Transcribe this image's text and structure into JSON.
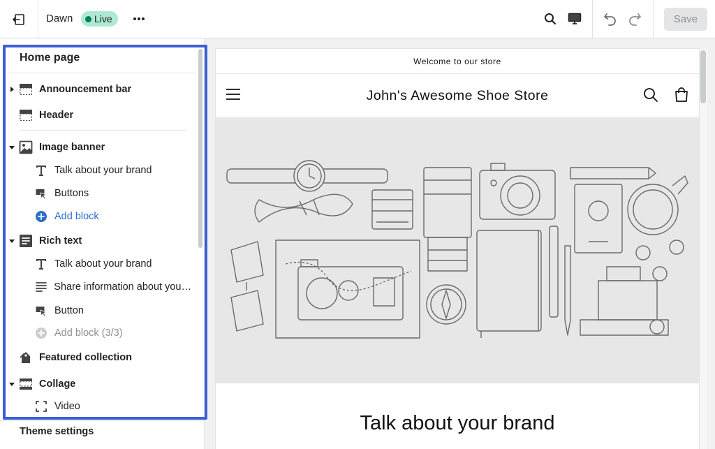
{
  "topbar": {
    "theme_name": "Dawn",
    "live_label": "Live",
    "save_label": "Save"
  },
  "sidebar": {
    "title": "Home page",
    "header_sections": [
      {
        "label": "Announcement bar",
        "icon": "announcement-bar-icon",
        "expandable": true
      },
      {
        "label": "Header",
        "icon": "header-icon",
        "expandable": false
      }
    ],
    "image_banner": {
      "label": "Image banner",
      "icon": "image-icon",
      "children": [
        {
          "label": "Talk about your brand",
          "icon": "text-icon"
        },
        {
          "label": "Buttons",
          "icon": "button-icon"
        }
      ],
      "add_label": "Add block"
    },
    "rich_text": {
      "label": "Rich text",
      "icon": "rich-text-icon",
      "children": [
        {
          "label": "Talk about your brand",
          "icon": "text-icon"
        },
        {
          "label": "Share information about your ...",
          "icon": "paragraph-icon"
        },
        {
          "label": "Button",
          "icon": "button-icon"
        }
      ],
      "add_label": "Add block (3/3)"
    },
    "featured_collection": {
      "label": "Featured collection",
      "icon": "tag-icon"
    },
    "collage": {
      "label": "Collage",
      "icon": "collage-icon",
      "children": [
        {
          "label": "Video",
          "icon": "video-frame-icon"
        }
      ]
    },
    "theme_settings_label": "Theme settings"
  },
  "preview": {
    "announcement": "Welcome to our store",
    "store_name": "John's Awesome Shoe Store",
    "brand_heading": "Talk about your brand"
  },
  "colors": {
    "accent": "#2c6ecb",
    "live_badge": "#aee9d1",
    "live_dot": "#007f5f",
    "highlight": "#3b5fd6"
  }
}
